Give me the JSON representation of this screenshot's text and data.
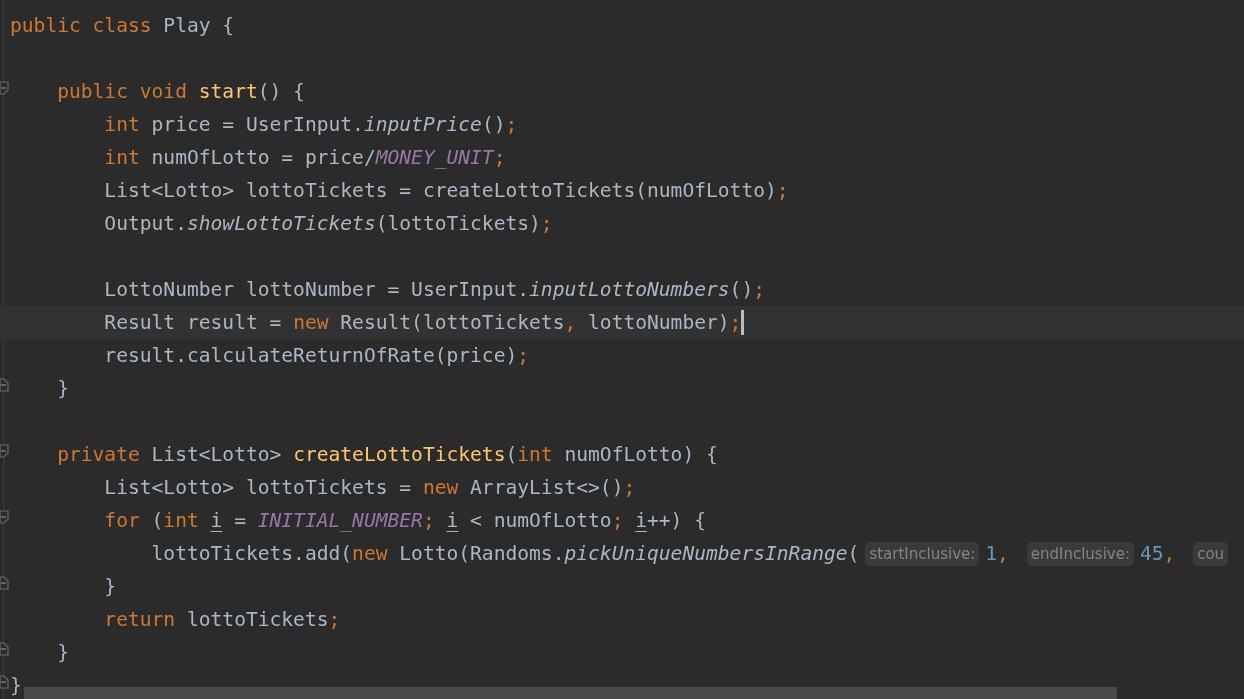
{
  "lines": [
    {
      "current": false,
      "kind": "code",
      "tokens": [
        {
          "kind": "kw",
          "text": "public class"
        },
        {
          "kind": "plain",
          "text": " Play {"
        }
      ]
    },
    {
      "current": false,
      "kind": "code"
    },
    {
      "current": false,
      "kind": "block-start",
      "tokens": [
        {
          "kind": "kw",
          "text": "    public void "
        },
        {
          "kind": "decl",
          "text": "start"
        },
        {
          "kind": "plain",
          "text": "() {"
        }
      ]
    },
    {
      "current": false,
      "kind": "code",
      "tokens": [
        {
          "kind": "kw",
          "text": "        int"
        },
        {
          "kind": "plain",
          "text": " price = UserInput."
        },
        {
          "kind": "call",
          "text": "inputPrice"
        },
        {
          "kind": "plain",
          "text": "()"
        },
        {
          "kind": "punct",
          "text": ";"
        }
      ]
    },
    {
      "current": false,
      "kind": "code",
      "tokens": [
        {
          "kind": "kw",
          "text": "        int"
        },
        {
          "kind": "plain",
          "text": " numOfLotto = price/"
        },
        {
          "kind": "const",
          "text": "MONEY_UNIT"
        },
        {
          "kind": "punct",
          "text": ";"
        }
      ]
    },
    {
      "current": false,
      "kind": "code",
      "tokens": [
        {
          "kind": "plain",
          "text": "        List<Lotto> lottoTickets = createLottoTickets(numOfLotto)"
        },
        {
          "kind": "punct",
          "text": ";"
        }
      ]
    },
    {
      "current": false,
      "kind": "code",
      "tokens": [
        {
          "kind": "plain",
          "text": "        Output."
        },
        {
          "kind": "call",
          "text": "showLottoTickets"
        },
        {
          "kind": "plain",
          "text": "(lottoTickets)"
        },
        {
          "kind": "punct",
          "text": ";"
        }
      ]
    },
    {
      "current": false,
      "kind": "code"
    },
    {
      "current": false,
      "kind": "code",
      "tokens": [
        {
          "kind": "plain",
          "text": "        LottoNumber lottoNumber = UserInput."
        },
        {
          "kind": "call",
          "text": "inputLottoNumbers"
        },
        {
          "kind": "plain",
          "text": "()"
        },
        {
          "kind": "punct",
          "text": ";"
        }
      ]
    },
    {
      "current": true,
      "kind": "code",
      "tokens": [
        {
          "kind": "plain",
          "text": "        Result result = "
        },
        {
          "kind": "kw",
          "text": "new"
        },
        {
          "kind": "plain",
          "text": " Result(lottoTickets"
        },
        {
          "kind": "punct",
          "text": ","
        },
        {
          "kind": "plain",
          "text": " lottoNumber)"
        },
        {
          "kind": "punct",
          "text": ";"
        }
      ]
    },
    {
      "current": false,
      "kind": "code",
      "tokens": [
        {
          "kind": "plain",
          "text": "        result.calculateReturnOfRate(price)"
        },
        {
          "kind": "punct",
          "text": ";"
        }
      ]
    },
    {
      "current": false,
      "kind": "block-end",
      "tokens": [
        {
          "kind": "plain",
          "text": "    }"
        }
      ]
    },
    {
      "current": false,
      "kind": "code"
    },
    {
      "current": false,
      "kind": "block-start",
      "tokens": [
        {
          "kind": "kw",
          "text": "    private"
        },
        {
          "kind": "plain",
          "text": " List<Lotto> "
        },
        {
          "kind": "decl",
          "text": "createLottoTickets"
        },
        {
          "kind": "plain",
          "text": "("
        },
        {
          "kind": "kw",
          "text": "int"
        },
        {
          "kind": "plain",
          "text": " numOfLotto) {"
        }
      ]
    },
    {
      "current": false,
      "kind": "code",
      "tokens": [
        {
          "kind": "plain",
          "text": "        List<Lotto> lottoTickets = "
        },
        {
          "kind": "kw",
          "text": "new"
        },
        {
          "kind": "plain",
          "text": " ArrayList<>()"
        },
        {
          "kind": "punct",
          "text": ";"
        }
      ]
    },
    {
      "current": false,
      "kind": "block-start",
      "tokens": [
        {
          "kind": "kw",
          "text": "        for"
        },
        {
          "kind": "plain",
          "text": " ("
        },
        {
          "kind": "kw",
          "text": "int "
        },
        {
          "kind": "var",
          "text": "i"
        },
        {
          "kind": "plain",
          "text": " = "
        },
        {
          "kind": "const",
          "text": "INITIAL_NUMBER"
        },
        {
          "kind": "punct",
          "text": "; "
        },
        {
          "kind": "var",
          "text": "i"
        },
        {
          "kind": "plain",
          "text": " < numOfLotto"
        },
        {
          "kind": "punct",
          "text": "; "
        },
        {
          "kind": "var",
          "text": "i"
        },
        {
          "kind": "plain",
          "text": "++) {"
        }
      ]
    },
    {
      "current": false,
      "kind": "code",
      "tokens": [
        {
          "kind": "plain",
          "text": "            lottoTickets.add("
        },
        {
          "kind": "kw",
          "text": "new"
        },
        {
          "kind": "plain",
          "text": " Lotto(Randoms."
        },
        {
          "kind": "call",
          "text": "pickUniqueNumbersInRange"
        },
        {
          "kind": "plain",
          "text": "("
        },
        {
          "kind": "hint",
          "text": "startInclusive:"
        },
        {
          "kind": "num",
          "text": "1"
        },
        {
          "kind": "punct",
          "text": ", "
        },
        {
          "kind": "hint",
          "text": "endInclusive:"
        },
        {
          "kind": "num",
          "text": "45"
        },
        {
          "kind": "punct",
          "text": ", "
        },
        {
          "kind": "hint",
          "text": "cou"
        }
      ]
    },
    {
      "current": false,
      "kind": "block-end",
      "tokens": [
        {
          "kind": "plain",
          "text": "        }"
        }
      ]
    },
    {
      "current": false,
      "kind": "code",
      "tokens": [
        {
          "kind": "kw",
          "text": "        return"
        },
        {
          "kind": "plain",
          "text": " lottoTickets"
        },
        {
          "kind": "punct",
          "text": ";"
        }
      ]
    },
    {
      "current": false,
      "kind": "block-end",
      "tokens": [
        {
          "kind": "plain",
          "text": "    }"
        }
      ]
    },
    {
      "current": false,
      "kind": "block-end",
      "tokens": [
        {
          "kind": "plain",
          "text": "}"
        }
      ]
    }
  ]
}
